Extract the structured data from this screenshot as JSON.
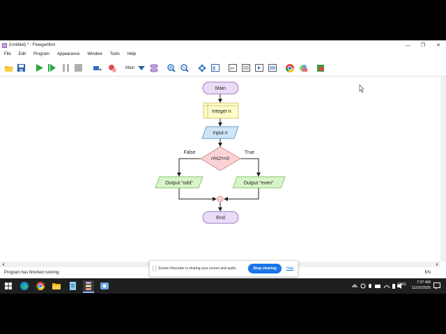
{
  "window": {
    "title": "(Untitled) * - Flowgorithm",
    "minimize_glyph": "—",
    "maximize_glyph": "❐",
    "close_glyph": "✕"
  },
  "menu": [
    "File",
    "Edit",
    "Program",
    "Appearance",
    "Window",
    "Tools",
    "Help"
  ],
  "toolbar": {
    "function_selector": "Main",
    "icons": [
      "open-icon",
      "save-icon",
      "run-icon",
      "step-icon",
      "pause-icon",
      "stop-icon",
      "breakpoint-icon",
      "clear-breakpoints-icon",
      "function-selector",
      "add-function-icon",
      "zoom-in-icon",
      "zoom-out-icon",
      "center-icon",
      "layout-icon",
      "variable-watch-icon",
      "console-icon",
      "source-view-icon",
      "chart-view-icon",
      "chrome-icon",
      "color-icon",
      "export-icon"
    ]
  },
  "flowchart": {
    "start_label": "Main",
    "declare_label": "Integer n",
    "input_label": "Input n",
    "decision_label": "n%2==0",
    "false_label": "False",
    "true_label": "True",
    "output_false_label": "Output \"odd\"",
    "output_true_label": "Output \"even\"",
    "end_label": "End",
    "colors": {
      "terminal_fill": "#eadcf6",
      "terminal_stroke": "#9b7cc4",
      "declare_fill": "#fdfbc7",
      "declare_stroke": "#d6c979",
      "io_fill": "#cfe4f8",
      "io_stroke": "#6e9ccf",
      "decision_fill": "#fad4d4",
      "decision_stroke": "#d08a8a",
      "output_fill": "#d8f5c8",
      "output_stroke": "#8cc26f"
    }
  },
  "status": {
    "message": "Program has finished running.",
    "language": "EN"
  },
  "share_banner": {
    "text": "Screen Recorder is sharing your screen and audio.",
    "stop_label": "Stop sharing",
    "hide_label": "Hide"
  },
  "taskbar": {
    "apps": [
      "start-icon",
      "edge-icon",
      "chrome-icon",
      "explorer-icon",
      "notepad-icon",
      "flowgorithm-icon",
      "recorder-icon"
    ],
    "tray_language": "ENG",
    "time": "7:37 AM",
    "date": "11/16/2025"
  }
}
